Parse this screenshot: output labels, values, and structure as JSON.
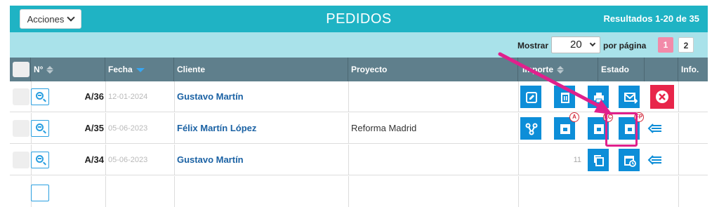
{
  "toolbar": {
    "acciones_label": "Acciones",
    "title": "PEDIDOS",
    "results": "Resultados 1-20 de 35"
  },
  "pagination": {
    "mostrar_label": "Mostrar",
    "per_page_value": "20",
    "por_pagina_label": "por página",
    "pages": [
      "1",
      "2"
    ],
    "current_page": "1"
  },
  "table": {
    "headers": {
      "num": "N°",
      "fecha": "Fecha",
      "cliente": "Cliente",
      "proyecto": "Proyecto",
      "importe": "Importe",
      "estado": "Estado",
      "info": "Info."
    },
    "rows": [
      {
        "num": "A/36",
        "fecha": "12-01-2024",
        "cliente": "Gustavo Martín",
        "proyecto": "",
        "importe": ""
      },
      {
        "num": "A/35",
        "fecha": "05-06-2023",
        "cliente": "Félix Martín López",
        "proyecto": "Reforma Madrid",
        "importe": ""
      },
      {
        "num": "A/34",
        "fecha": "05-06-2023",
        "cliente": "Gustavo Martín",
        "proyecto": "",
        "importe": "11"
      }
    ]
  },
  "actions": {
    "badges": {
      "a": "A",
      "ec": "EC",
      "fp": "FP"
    },
    "icons": [
      "edit-icon",
      "trash-icon",
      "print-icon",
      "send-email-icon",
      "close-icon",
      "branch-icon",
      "document-a-icon",
      "document-ec-icon",
      "document-fp-icon",
      "collapse-arrow-icon",
      "copy-icon",
      "calendar-history-icon"
    ]
  },
  "colors": {
    "accent": "#1fb3c4",
    "header_bg": "#5f7f8c",
    "action_blue": "#0d8ed8",
    "delete_red": "#e8264a",
    "highlight_pink": "#e0208c",
    "page_active": "#f28aa9"
  }
}
